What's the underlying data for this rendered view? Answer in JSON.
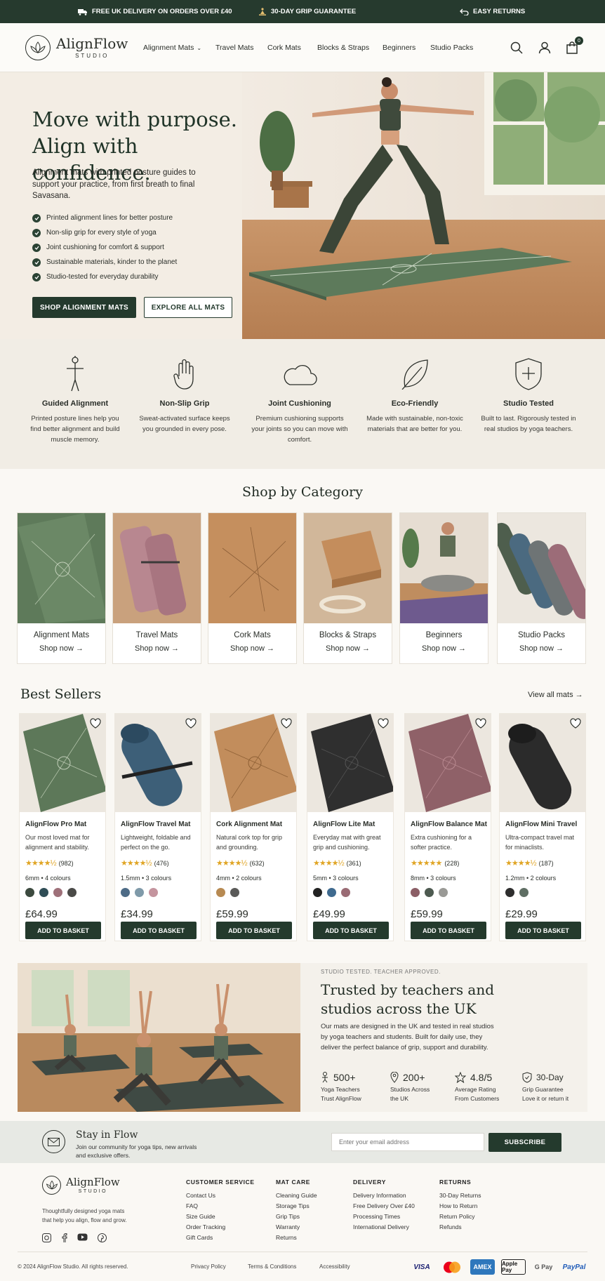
{
  "topbar": {
    "delivery": "FREE UK DELIVERY ON ORDERS OVER £40",
    "guarantee": "30-DAY GRIP GUARANTEE",
    "returns": "EASY RETURNS"
  },
  "brand": {
    "name": "AlignFlow",
    "sub": "STUDIO"
  },
  "nav": [
    "Alignment Mats",
    "Travel Mats",
    "Cork Mats",
    "Blocks & Straps",
    "Beginners",
    "Studio Packs"
  ],
  "cart_count": "0",
  "hero": {
    "line1": "Move with purpose.",
    "line2": "Align with confidence.",
    "lead": "Alignment mats with printed posture guides to support your practice, from first breath to final Savasana.",
    "bullets": [
      "Printed alignment lines for better posture",
      "Non-slip grip for every style of yoga",
      "Joint cushioning for comfort & support",
      "Sustainable materials, kinder to the planet",
      "Studio-tested for everyday durability"
    ],
    "cta_primary": "SHOP ALIGNMENT MATS",
    "cta_secondary": "EXPLORE ALL MATS"
  },
  "features": [
    {
      "icon": "posture-figure-icon",
      "title": "Guided Alignment",
      "desc": "Printed posture lines help you find better alignment and build muscle memory."
    },
    {
      "icon": "hand-icon",
      "title": "Non-Slip Grip",
      "desc": "Sweat-activated surface keeps you grounded in every pose."
    },
    {
      "icon": "cloud-icon",
      "title": "Joint Cushioning",
      "desc": "Premium cushioning supports your joints so you can move with comfort."
    },
    {
      "icon": "leaf-icon",
      "title": "Eco-Friendly",
      "desc": "Made with sustainable, non-toxic materials that are better for you."
    },
    {
      "icon": "shield-plus-icon",
      "title": "Studio Tested",
      "desc": "Built to last. Rigorously tested in real studios by yoga teachers."
    }
  ],
  "categories_title": "Shop by Category",
  "categories": [
    {
      "name": "Alignment Mats",
      "link": "Shop now →"
    },
    {
      "name": "Travel Mats",
      "link": "Shop now →"
    },
    {
      "name": "Cork Mats",
      "link": "Shop now →"
    },
    {
      "name": "Blocks & Straps",
      "link": "Shop now →"
    },
    {
      "name": "Beginners",
      "link": "Shop now →"
    },
    {
      "name": "Studio Packs",
      "link": "Shop now →"
    }
  ],
  "bestsellers": {
    "title": "Best Sellers",
    "view_all": "View all mats →",
    "add_label": "ADD TO BASKET",
    "products": [
      {
        "name": "AlignFlow Pro Mat",
        "desc": "Our most loved mat for alignment and stability.",
        "stars": "★★★★½",
        "reviews": "(982)",
        "size": "6mm • 4 colours",
        "price": "£64.99",
        "swatches": [
          "#3c4a3f",
          "#2f4d56",
          "#9e7079",
          "#4a4a47"
        ]
      },
      {
        "name": "AlignFlow Travel Mat",
        "desc": "Lightweight, foldable and perfect on the go.",
        "stars": "★★★★½",
        "reviews": "(476)",
        "size": "1.5mm • 3 colours",
        "price": "£34.99",
        "swatches": [
          "#4d6b86",
          "#7f9aa9",
          "#c4949e"
        ]
      },
      {
        "name": "Cork Alignment Mat",
        "desc": "Natural cork top for grip and grounding.",
        "stars": "★★★★½",
        "reviews": "(632)",
        "size": "4mm • 2 colours",
        "price": "£59.99",
        "swatches": [
          "#b78a52",
          "#5a5a58"
        ]
      },
      {
        "name": "AlignFlow Lite Mat",
        "desc": "Everyday mat with great grip and cushioning.",
        "stars": "★★★★½",
        "reviews": "(361)",
        "size": "5mm • 3 colours",
        "price": "£49.99",
        "swatches": [
          "#222222",
          "#3f6a8f",
          "#9a6b74"
        ]
      },
      {
        "name": "AlignFlow Balance Mat",
        "desc": "Extra cushioning for a softer practice.",
        "stars": "★★★★★",
        "reviews": "(228)",
        "size": "8mm • 3 colours",
        "price": "£59.99",
        "swatches": [
          "#8b5e66",
          "#4d5a50",
          "#9a9a96"
        ]
      },
      {
        "name": "AlignFlow Mini Travel",
        "desc": "Ultra-compact travel mat for minaclists.",
        "stars": "★★★★½",
        "reviews": "(187)",
        "size": "1.2mm • 2 colours",
        "price": "£29.99",
        "swatches": [
          "#2e2e2e",
          "#5f6e64"
        ]
      }
    ]
  },
  "trusted": {
    "eyebrow": "STUDIO TESTED. TEACHER APPROVED.",
    "title_l1": "Trusted by teachers and",
    "title_l2": "studios across the UK",
    "body": "Our mats are designed in the UK and tested in real studios by yoga teachers and students. Built for daily use, they deliver the perfect balance of grip, support and durability.",
    "stats": [
      {
        "value": "500+",
        "l1": "Yoga Teachers",
        "l2": "Trust AlignFlow"
      },
      {
        "value": "200+",
        "l1": "Studios Across",
        "l2": "the UK"
      },
      {
        "value": "4.8/5",
        "l1": "Average Rating",
        "l2": "From Customers"
      },
      {
        "value": "30-Day",
        "l1": "Grip Guarantee",
        "l2": "Love it or return it"
      }
    ]
  },
  "newsletter": {
    "title": "Stay in Flow",
    "l1": "Join our community for yoga tips, new arrivals",
    "l2": "and exclusive offers.",
    "placeholder": "Enter your email address",
    "button": "SUBSCRIBE"
  },
  "footer": {
    "tagline_l1": "Thoughtfully designed yoga mats",
    "tagline_l2": "that help you align, flow and grow.",
    "columns": [
      {
        "title": "CUSTOMER SERVICE",
        "items": [
          "Contact Us",
          "FAQ",
          "Size Guide",
          "Order Tracking",
          "Gift Cards"
        ]
      },
      {
        "title": "MAT CARE",
        "items": [
          "Cleaning Guide",
          "Storage Tips",
          "Grip Tips",
          "Warranty",
          "Returns"
        ]
      },
      {
        "title": "DELIVERY",
        "items": [
          "Delivery Information",
          "Free Delivery Over £40",
          "Processing Times",
          "International Delivery"
        ]
      },
      {
        "title": "RETURNS",
        "items": [
          "30-Day Returns",
          "How to Return",
          "Return Policy",
          "Refunds"
        ]
      }
    ],
    "copyright": "© 2024 AlignFlow Studio. All rights reserved.",
    "links": [
      "Privacy Policy",
      "Terms & Conditions",
      "Accessibility"
    ],
    "payments": [
      "VISA",
      "Mastercard",
      "AMEX",
      "Apple Pay",
      "G Pay",
      "PayPal"
    ]
  }
}
